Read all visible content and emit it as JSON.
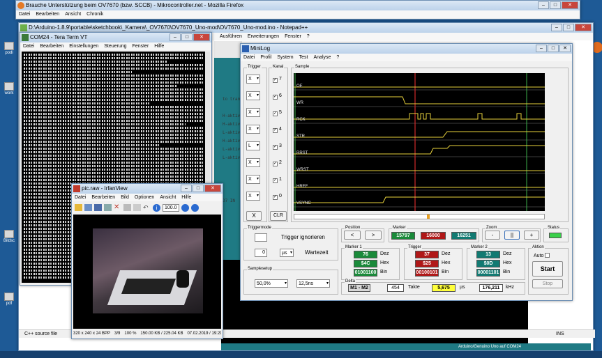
{
  "colors": {
    "desktop": "#1e5a96",
    "scope_bg": "#000000",
    "trace": "#e8d23c",
    "cursor_red": "#d22a2a",
    "cursor_green": "#3cb04a",
    "hex_green": "#1a8a3a",
    "hex_red": "#b01818",
    "hex_teal": "#127a72"
  },
  "browser": {
    "title": "Brauche Unterstützung beim OV7670 (bzw. SCCB) - Mikrocontroller.net - Mozilla Firefox",
    "menu": [
      "Datei",
      "Bearbeiten",
      "Ansicht",
      "Chronik"
    ]
  },
  "notepad": {
    "title": "D:\\Arduino-1.8.9\\portable\\sketchbook\\_Kamera\\_OV7670\\OV7670_Uno-mod\\OV7670_Uno-mod.ino - Notepad++",
    "menu": [
      "Ausführen",
      "Erweiterungen",
      "Fenster",
      "?"
    ],
    "code_snippets": [
      "to transm",
      "H-aktiv",
      "H-aktiv",
      "L-aktiv",
      "H-aktiv",
      "L-aktiv",
      "L-aktiv",
      "D7 IN"
    ],
    "status_file": "C++ source file",
    "status_ins": "INS",
    "ide_status": "Arduino/Genuino Uno auf COM24"
  },
  "teraterm": {
    "title": "COM24 - Tera Term VT",
    "menu": [
      "Datei",
      "Bearbeiten",
      "Einstellungen",
      "Steuerung",
      "Fenster",
      "Hilfe"
    ]
  },
  "irfan": {
    "title": "pic.raw - IrfanView",
    "menu": [
      "Datei",
      "Bearbeiten",
      "Bild",
      "Optionen",
      "Ansicht",
      "Hilfe"
    ],
    "zoom": "100.0",
    "status": [
      "320 x 240 x 24 BPP",
      "3/9",
      "100 %",
      "150.00 KB / 225.04 KB",
      "07.02.2019 / 19:29:"
    ]
  },
  "minilog": {
    "title": "MiniLog",
    "menu": [
      "Datei",
      "Profil",
      "System",
      "Test",
      "Analyse",
      "?"
    ],
    "trigger_label": "Trigger",
    "kanal_label": "Kanal",
    "sample_label": "Sample",
    "channels": [
      {
        "trig": "X",
        "num": "7",
        "signal": "OE"
      },
      {
        "trig": "X",
        "num": "6",
        "signal": "WR"
      },
      {
        "trig": "X",
        "num": "5",
        "signal": "RCK"
      },
      {
        "trig": "X",
        "num": "4",
        "signal": "STR"
      },
      {
        "trig": "L",
        "num": "3",
        "signal": "RRST"
      },
      {
        "trig": "X",
        "num": "2",
        "signal": "WRST"
      },
      {
        "trig": "X",
        "num": "1",
        "signal": "HREF"
      },
      {
        "trig": "X",
        "num": "0",
        "signal": "VSYNC"
      }
    ],
    "btn_x": "X",
    "btn_clr": "CLR",
    "triggermode_label": "Triggermode",
    "trigger_ignore": "Trigger ignorieren",
    "wait_value": "0",
    "wait_unit": "µs",
    "wait_label": "Wartezeit",
    "samplesetup_label": "Samplesetup",
    "sample_percent": "50,0%",
    "sample_time": "12,5ns",
    "position_label": "Position",
    "pos_prev": "<",
    "pos_next": ">",
    "marker_label": "Marker",
    "marker_vals": [
      "15797",
      "16000",
      "16251"
    ],
    "zoom_label": "Zoom",
    "zoom_minus": "-",
    "zoom_pause": "||",
    "zoom_plus": "+",
    "status_label": "Status",
    "marker1": {
      "label": "Marker 1",
      "dec": "76",
      "hex": "$4C",
      "bin": "01001100"
    },
    "trigger": {
      "label": "Trigger",
      "dec": "37",
      "hex": "$25",
      "bin": "00100101"
    },
    "marker2": {
      "label": "Marker 2",
      "dec": "13",
      "hex": "$0D",
      "bin": "00001101"
    },
    "dec_label": "Dez",
    "hex_label": "Hex",
    "bin_label": "Bin",
    "delta_label": "Delta",
    "delta_pair": "M1 - M2",
    "delta_takte": "454",
    "takte_label": "Takte",
    "delta_us": "5,675",
    "us_label": "µs",
    "delta_khz": "176,211",
    "khz_label": "kHz",
    "aktion_label": "Aktion",
    "auto_label": "Auto",
    "start_label": "Start",
    "stop_label": "Stop"
  },
  "desktop_icons": [
    "podi",
    "work",
    "Bildsc",
    "pdf"
  ]
}
